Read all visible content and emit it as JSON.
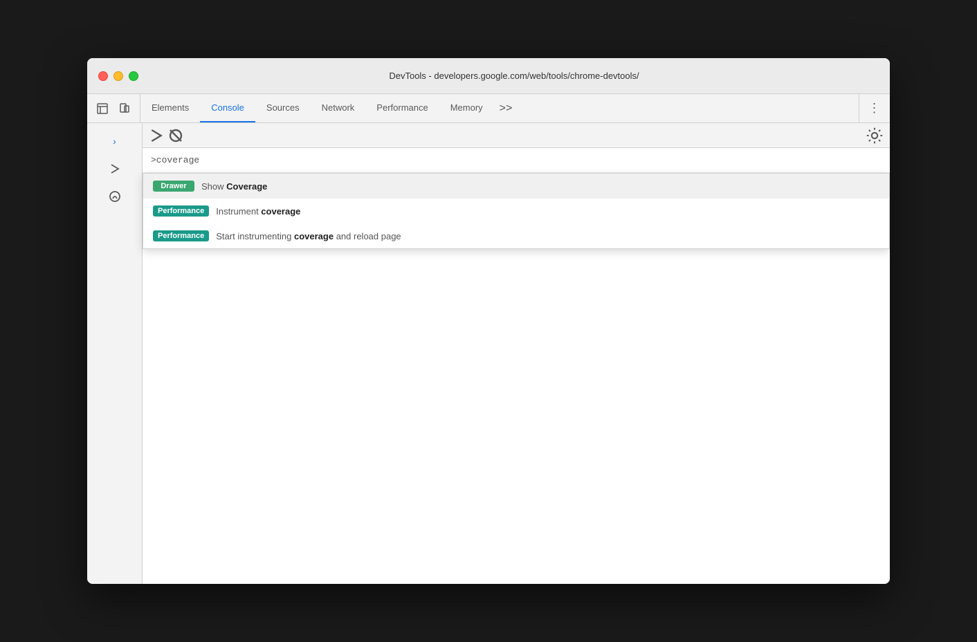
{
  "window": {
    "title": "DevTools - developers.google.com/web/tools/chrome-devtools/"
  },
  "traffic_lights": {
    "close_label": "close",
    "minimize_label": "minimize",
    "maximize_label": "maximize"
  },
  "tabs": [
    {
      "id": "elements",
      "label": "Elements",
      "active": false
    },
    {
      "id": "console",
      "label": "Console",
      "active": true
    },
    {
      "id": "sources",
      "label": "Sources",
      "active": false
    },
    {
      "id": "network",
      "label": "Network",
      "active": false
    },
    {
      "id": "performance",
      "label": "Performance",
      "active": false
    },
    {
      "id": "memory",
      "label": "Memory",
      "active": false
    }
  ],
  "tabs_more_label": ">>",
  "input": {
    "value": ">coverage"
  },
  "autocomplete": {
    "items": [
      {
        "badge": "Drawer",
        "badge_class": "drawer",
        "text_prefix": "Show ",
        "text_bold": "Coverage",
        "text_suffix": ""
      },
      {
        "badge": "Performance",
        "badge_class": "performance",
        "text_prefix": "Instrument ",
        "text_bold": "coverage",
        "text_suffix": ""
      },
      {
        "badge": "Performance",
        "badge_class": "performance",
        "text_prefix": "Start instrumenting ",
        "text_bold": "coverage",
        "text_suffix": " and reload page"
      }
    ]
  },
  "icons": {
    "cursor_icon": "⬆",
    "layers_icon": "⬛",
    "play_icon": "▶",
    "filter_icon": "⊘",
    "gear_icon": "⚙"
  }
}
